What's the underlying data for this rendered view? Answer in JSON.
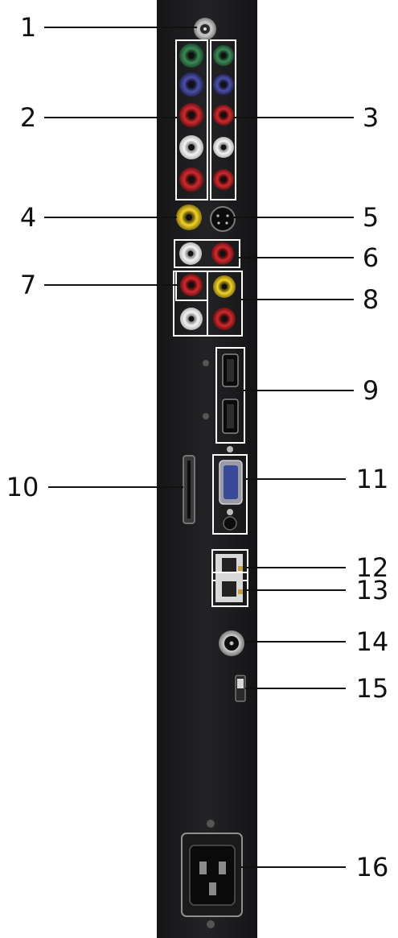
{
  "callouts": [
    {
      "n": "1",
      "side": "left",
      "target": "coax-connector"
    },
    {
      "n": "2",
      "side": "left",
      "target": "component-input-group-1"
    },
    {
      "n": "3",
      "side": "right",
      "target": "component-input-group-2"
    },
    {
      "n": "4",
      "side": "left",
      "target": "composite-video-jack"
    },
    {
      "n": "5",
      "side": "right",
      "target": "s-video-jack"
    },
    {
      "n": "6",
      "side": "right",
      "target": "audio-pair-upper"
    },
    {
      "n": "7",
      "side": "left",
      "target": "audio-single-jack"
    },
    {
      "n": "8",
      "side": "right",
      "target": "av-jack-group"
    },
    {
      "n": "9",
      "side": "right",
      "target": "hdmi-ports"
    },
    {
      "n": "10",
      "side": "left",
      "target": "card-slot"
    },
    {
      "n": "11",
      "side": "right",
      "target": "vga-and-audio-port"
    },
    {
      "n": "12",
      "side": "right",
      "target": "rj45-port-upper"
    },
    {
      "n": "13",
      "side": "right",
      "target": "rj45-port-lower"
    },
    {
      "n": "14",
      "side": "right",
      "target": "round-dc-jack"
    },
    {
      "n": "15",
      "side": "right",
      "target": "slide-switch"
    },
    {
      "n": "16",
      "side": "right",
      "target": "ac-power-inlet"
    }
  ],
  "colors": {
    "panel": "#1d1d1f",
    "jack_green": "#2f7a4a",
    "jack_blue": "#3b3f8c",
    "jack_red": "#b52226",
    "jack_white": "#e8e8e8",
    "jack_yellow": "#e3c21a",
    "outline": "#ffffff"
  }
}
